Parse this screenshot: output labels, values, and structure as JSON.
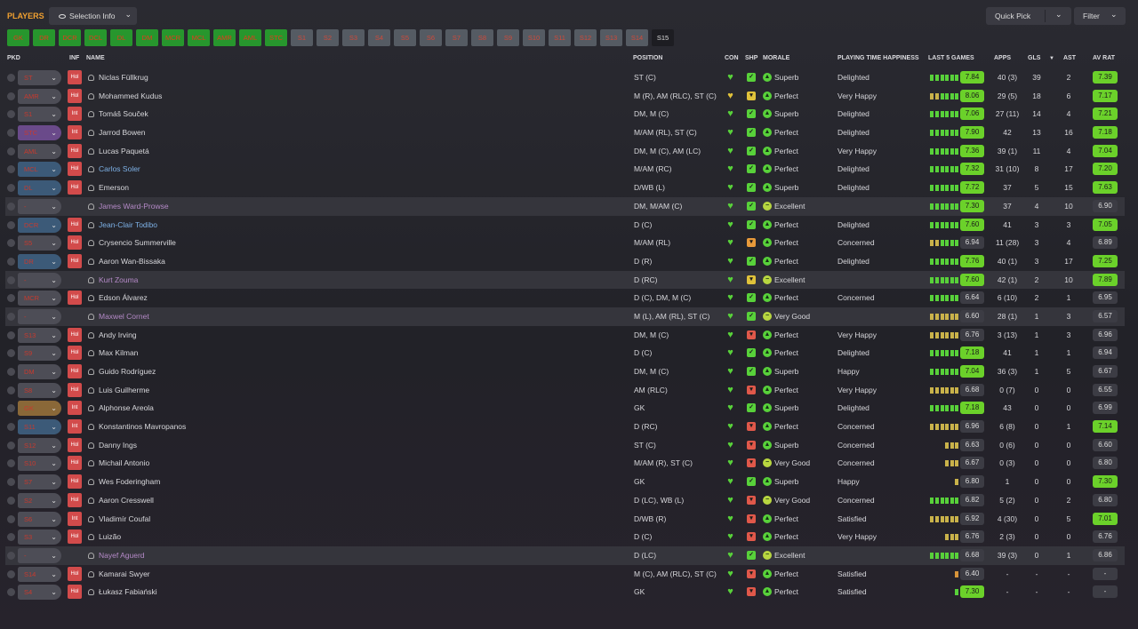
{
  "header": {
    "title": "PLAYERS",
    "selection_label": "Selection Info",
    "quick_pick_label": "Quick Pick",
    "filter_label": "Filter"
  },
  "tabs": [
    "GK",
    "DR",
    "DCR",
    "DCL",
    "DL",
    "DM",
    "MCR",
    "MCL",
    "AMR",
    "AML",
    "STC",
    "S1",
    "S2",
    "S3",
    "S4",
    "S5",
    "S6",
    "S7",
    "S8",
    "S9",
    "S10",
    "S11",
    "S12",
    "S13",
    "S14",
    "S15"
  ],
  "columns": {
    "pkd": "PKD",
    "inf": "INF",
    "name": "NAME",
    "position": "POSITION",
    "con": "CON",
    "shp": "SHP",
    "morale": "MORALE",
    "happiness": "PLAYING TIME HAPPINESS",
    "last5": "LAST 5 GAMES",
    "apps": "APPS",
    "gls": "GLS",
    "ast": "AST",
    "avrat": "AV RAT"
  },
  "colors": {
    "accent": "#f0a030",
    "good_rating": "#6bd12a",
    "bar_green": "#58d13a",
    "bar_yellow": "#c9b24a",
    "inf_badge": "#d24b4b"
  },
  "players": [
    {
      "pos": "ST",
      "posc": "",
      "inf": "Hol",
      "name": "Niclas Füllkrug",
      "nc": "",
      "position": "ST (C)",
      "shp": "g",
      "morale": "Superb",
      "mc": "g",
      "happy": "Delighted",
      "bars": "gggggg",
      "r5": "7.84",
      "r5c": "g",
      "apps": "40 (3)",
      "gls": "39",
      "ast": "2",
      "av": "7.39",
      "avc": "g"
    },
    {
      "pos": "AMR",
      "posc": "",
      "inf": "Hol",
      "name": "Mohammed Kudus",
      "nc": "",
      "position": "M (R), AM (RLC), ST (C)",
      "shp": "y",
      "morale": "Perfect",
      "mc": "g",
      "happy": "Very Happy",
      "bars": "yygggg",
      "r5": "8.06",
      "r5c": "g",
      "apps": "29 (5)",
      "gls": "18",
      "ast": "6",
      "av": "7.17",
      "avc": "g"
    },
    {
      "pos": "S1",
      "posc": "",
      "inf": "Int",
      "name": "Tomáš Souček",
      "nc": "",
      "position": "DM, M (C)",
      "shp": "g",
      "morale": "Superb",
      "mc": "g",
      "happy": "Delighted",
      "bars": "gggggg",
      "r5": "7.06",
      "r5c": "g",
      "apps": "27 (11)",
      "gls": "14",
      "ast": "4",
      "av": "7.21",
      "avc": "g"
    },
    {
      "pos": "STC",
      "posc": "p",
      "inf": "Int",
      "name": "Jarrod Bowen",
      "nc": "",
      "position": "M/AM (RL), ST (C)",
      "shp": "g",
      "morale": "Perfect",
      "mc": "g",
      "happy": "Delighted",
      "bars": "gggggg",
      "r5": "7.90",
      "r5c": "g",
      "apps": "42",
      "gls": "13",
      "ast": "16",
      "av": "7.18",
      "avc": "g"
    },
    {
      "pos": "AML",
      "posc": "",
      "inf": "Hol",
      "name": "Lucas Paquetá",
      "nc": "",
      "position": "DM, M (C), AM (LC)",
      "shp": "g",
      "morale": "Perfect",
      "mc": "g",
      "happy": "Very Happy",
      "bars": "gggggg",
      "r5": "7.36",
      "r5c": "g",
      "apps": "39 (1)",
      "gls": "11",
      "ast": "4",
      "av": "7.04",
      "avc": "g"
    },
    {
      "pos": "MCL",
      "posc": "b",
      "inf": "Hol",
      "name": "Carlos Soler",
      "nc": "blue",
      "position": "M/AM (RC)",
      "shp": "g",
      "morale": "Perfect",
      "mc": "g",
      "happy": "Delighted",
      "bars": "gggggg",
      "r5": "7.32",
      "r5c": "g",
      "apps": "31 (10)",
      "gls": "8",
      "ast": "17",
      "av": "7.20",
      "avc": "g"
    },
    {
      "pos": "DL",
      "posc": "b",
      "inf": "Hol",
      "name": "Emerson",
      "nc": "",
      "position": "D/WB (L)",
      "shp": "g",
      "morale": "Superb",
      "mc": "g",
      "happy": "Delighted",
      "bars": "gggggg",
      "r5": "7.72",
      "r5c": "g",
      "apps": "37",
      "gls": "5",
      "ast": "15",
      "av": "7.63",
      "avc": "g"
    },
    {
      "pos": "-",
      "posc": "",
      "inf": "",
      "name": "James Ward-Prowse",
      "nc": "purp",
      "position": "DM, M/AM (C)",
      "shp": "g",
      "morale": "Excellent",
      "mc": "y",
      "happy": "",
      "bars": "gggggg",
      "r5": "7.30",
      "r5c": "g",
      "apps": "37",
      "gls": "4",
      "ast": "10",
      "av": "6.90",
      "avc": "n"
    },
    {
      "pos": "DCR",
      "posc": "b",
      "inf": "Hol",
      "name": "Jean-Clair Todibo",
      "nc": "blue",
      "position": "D (C)",
      "shp": "g",
      "morale": "Perfect",
      "mc": "g",
      "happy": "Delighted",
      "bars": "gggggg",
      "r5": "7.60",
      "r5c": "g",
      "apps": "41",
      "gls": "3",
      "ast": "3",
      "av": "7.05",
      "avc": "g"
    },
    {
      "pos": "S5",
      "posc": "",
      "inf": "Hol",
      "name": "Crysencio Summerville",
      "nc": "",
      "position": "M/AM (RL)",
      "shp": "o",
      "morale": "Perfect",
      "mc": "g",
      "happy": "Concerned",
      "bars": "yygggg",
      "r5": "6.94",
      "r5c": "n",
      "apps": "11 (28)",
      "gls": "3",
      "ast": "4",
      "av": "6.89",
      "avc": "n"
    },
    {
      "pos": "DR",
      "posc": "b",
      "inf": "Hol",
      "name": "Aaron Wan-Bissaka",
      "nc": "",
      "position": "D (R)",
      "shp": "g",
      "morale": "Perfect",
      "mc": "g",
      "happy": "Delighted",
      "bars": "gggggg",
      "r5": "7.76",
      "r5c": "g",
      "apps": "40 (1)",
      "gls": "3",
      "ast": "17",
      "av": "7.25",
      "avc": "g"
    },
    {
      "pos": "-",
      "posc": "",
      "inf": "",
      "name": "Kurt Zouma",
      "nc": "purp",
      "position": "D (RC)",
      "shp": "y",
      "morale": "Excellent",
      "mc": "y",
      "happy": "",
      "bars": "gggggg",
      "r5": "7.60",
      "r5c": "g",
      "apps": "42 (1)",
      "gls": "2",
      "ast": "10",
      "av": "7.89",
      "avc": "g"
    },
    {
      "pos": "MCR",
      "posc": "",
      "inf": "Hol",
      "name": "Edson Álvarez",
      "nc": "",
      "position": "D (C), DM, M (C)",
      "shp": "g",
      "morale": "Perfect",
      "mc": "g",
      "happy": "Concerned",
      "bars": "gggggg",
      "r5": "6.64",
      "r5c": "n",
      "apps": "6 (10)",
      "gls": "2",
      "ast": "1",
      "av": "6.95",
      "avc": "n"
    },
    {
      "pos": "-",
      "posc": "",
      "inf": "",
      "name": "Maxwel Cornet",
      "nc": "purp",
      "position": "M (L), AM (RL), ST (C)",
      "shp": "g",
      "morale": "Very Good",
      "mc": "y",
      "happy": "",
      "bars": "yyyyyy",
      "r5": "6.60",
      "r5c": "n",
      "apps": "28 (1)",
      "gls": "1",
      "ast": "3",
      "av": "6.57",
      "avc": "n"
    },
    {
      "pos": "S13",
      "posc": "",
      "inf": "Hol",
      "name": "Andy Irving",
      "nc": "",
      "position": "DM, M (C)",
      "shp": "r",
      "morale": "Perfect",
      "mc": "g",
      "happy": "Very Happy",
      "bars": "yyyyyy",
      "r5": "6.76",
      "r5c": "n",
      "apps": "3 (13)",
      "gls": "1",
      "ast": "3",
      "av": "6.96",
      "avc": "n"
    },
    {
      "pos": "S9",
      "posc": "",
      "inf": "Hol",
      "name": "Max Kilman",
      "nc": "",
      "position": "D (C)",
      "shp": "g",
      "morale": "Perfect",
      "mc": "g",
      "happy": "Delighted",
      "bars": "gggggg",
      "r5": "7.18",
      "r5c": "g",
      "apps": "41",
      "gls": "1",
      "ast": "1",
      "av": "6.94",
      "avc": "n"
    },
    {
      "pos": "DM",
      "posc": "",
      "inf": "Hol",
      "name": "Guido Rodríguez",
      "nc": "",
      "position": "DM, M (C)",
      "shp": "g",
      "morale": "Superb",
      "mc": "g",
      "happy": "Happy",
      "bars": "gggggg",
      "r5": "7.04",
      "r5c": "g",
      "apps": "36 (3)",
      "gls": "1",
      "ast": "5",
      "av": "6.67",
      "avc": "n"
    },
    {
      "pos": "S8",
      "posc": "",
      "inf": "Hol",
      "name": "Luis Guilherme",
      "nc": "",
      "position": "AM (RLC)",
      "shp": "r",
      "morale": "Perfect",
      "mc": "g",
      "happy": "Very Happy",
      "bars": "yyyyyy",
      "r5": "6.68",
      "r5c": "n",
      "apps": "0 (7)",
      "gls": "0",
      "ast": "0",
      "av": "6.55",
      "avc": "n"
    },
    {
      "pos": "GK",
      "posc": "o",
      "inf": "Int",
      "name": "Alphonse Areola",
      "nc": "",
      "position": "GK",
      "shp": "g",
      "morale": "Superb",
      "mc": "g",
      "happy": "Delighted",
      "bars": "gggggg",
      "r5": "7.18",
      "r5c": "g",
      "apps": "43",
      "gls": "0",
      "ast": "0",
      "av": "6.99",
      "avc": "n"
    },
    {
      "pos": "S11",
      "posc": "b",
      "inf": "Int",
      "name": "Konstantinos Mavropanos",
      "nc": "",
      "position": "D (RC)",
      "shp": "r",
      "morale": "Perfect",
      "mc": "g",
      "happy": "Concerned",
      "bars": "yyyyyy",
      "r5": "6.96",
      "r5c": "n",
      "apps": "6 (8)",
      "gls": "0",
      "ast": "1",
      "av": "7.14",
      "avc": "g"
    },
    {
      "pos": "S12",
      "posc": "",
      "inf": "Hol",
      "name": "Danny Ings",
      "nc": "",
      "position": "ST (C)",
      "shp": "r",
      "morale": "Superb",
      "mc": "g",
      "happy": "Concerned",
      "bars": "yyy",
      "r5": "6.63",
      "r5c": "n",
      "apps": "0 (6)",
      "gls": "0",
      "ast": "0",
      "av": "6.60",
      "avc": "n"
    },
    {
      "pos": "S10",
      "posc": "",
      "inf": "Hol",
      "name": "Michail Antonio",
      "nc": "",
      "position": "M/AM (R), ST (C)",
      "shp": "r",
      "morale": "Very Good",
      "mc": "y",
      "happy": "Concerned",
      "bars": "yyy",
      "r5": "6.67",
      "r5c": "n",
      "apps": "0 (3)",
      "gls": "0",
      "ast": "0",
      "av": "6.80",
      "avc": "n"
    },
    {
      "pos": "S7",
      "posc": "",
      "inf": "Hol",
      "name": "Wes Foderingham",
      "nc": "",
      "position": "GK",
      "shp": "g",
      "morale": "Superb",
      "mc": "g",
      "happy": "Happy",
      "bars": "y",
      "r5": "6.80",
      "r5c": "n",
      "apps": "1",
      "gls": "0",
      "ast": "0",
      "av": "7.30",
      "avc": "g"
    },
    {
      "pos": "S2",
      "posc": "",
      "inf": "Hol",
      "name": "Aaron Cresswell",
      "nc": "",
      "position": "D (LC), WB (L)",
      "shp": "r",
      "morale": "Very Good",
      "mc": "y",
      "happy": "Concerned",
      "bars": "gggggg",
      "r5": "6.82",
      "r5c": "n",
      "apps": "5 (2)",
      "gls": "0",
      "ast": "2",
      "av": "6.80",
      "avc": "n"
    },
    {
      "pos": "S6",
      "posc": "",
      "inf": "Int",
      "name": "Vladimír Coufal",
      "nc": "",
      "position": "D/WB (R)",
      "shp": "r",
      "morale": "Perfect",
      "mc": "g",
      "happy": "Satisfied",
      "bars": "yyyyyy",
      "r5": "6.92",
      "r5c": "n",
      "apps": "4 (30)",
      "gls": "0",
      "ast": "5",
      "av": "7.01",
      "avc": "g"
    },
    {
      "pos": "S3",
      "posc": "",
      "inf": "Hol",
      "name": "Luizão",
      "nc": "",
      "position": "D (C)",
      "shp": "r",
      "morale": "Perfect",
      "mc": "g",
      "happy": "Very Happy",
      "bars": "yyy",
      "r5": "6.76",
      "r5c": "n",
      "apps": "2 (3)",
      "gls": "0",
      "ast": "0",
      "av": "6.76",
      "avc": "n"
    },
    {
      "pos": "-",
      "posc": "",
      "inf": "",
      "name": "Nayef Aguerd",
      "nc": "purp",
      "position": "D (LC)",
      "shp": "g",
      "morale": "Excellent",
      "mc": "y",
      "happy": "",
      "bars": "gggggg",
      "r5": "6.68",
      "r5c": "n",
      "apps": "39 (3)",
      "gls": "0",
      "ast": "1",
      "av": "6.86",
      "avc": "n"
    },
    {
      "pos": "S14",
      "posc": "",
      "inf": "Hol",
      "name": "Kamarai Swyer",
      "nc": "",
      "position": "M (C), AM (RLC), ST (C)",
      "shp": "r",
      "morale": "Perfect",
      "mc": "g",
      "happy": "Satisfied",
      "bars": "o",
      "r5": "6.40",
      "r5c": "n",
      "apps": "-",
      "gls": "-",
      "ast": "-",
      "av": "-",
      "avc": "n"
    },
    {
      "pos": "S4",
      "posc": "",
      "inf": "Hol",
      "name": "Łukasz Fabiański",
      "nc": "",
      "position": "GK",
      "shp": "r",
      "morale": "Perfect",
      "mc": "g",
      "happy": "Satisfied",
      "bars": "g",
      "r5": "7.30",
      "r5c": "g",
      "apps": "-",
      "gls": "-",
      "ast": "-",
      "av": "-",
      "avc": "n"
    }
  ]
}
